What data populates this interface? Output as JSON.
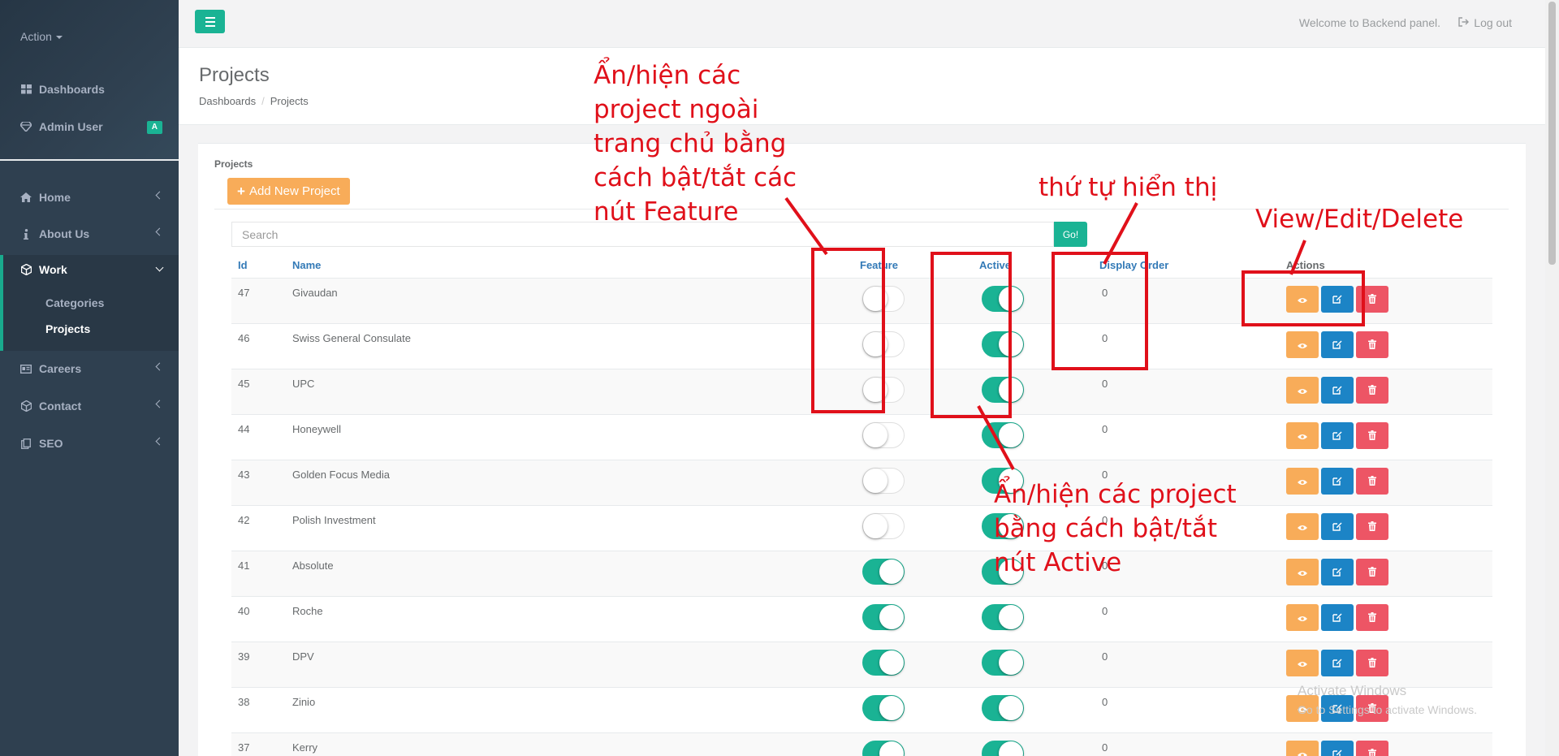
{
  "sidebar": {
    "action_label": "Action",
    "top_items": [
      {
        "label": "Dashboards",
        "icon": "dashboard-icon"
      },
      {
        "label": "Admin User",
        "icon": "diamond-icon",
        "badge": "A"
      }
    ],
    "menu": [
      {
        "label": "Home",
        "icon": "home-icon"
      },
      {
        "label": "About Us",
        "icon": "info-icon"
      },
      {
        "label": "Work",
        "icon": "cube-icon",
        "expanded": true,
        "children": [
          "Categories",
          "Projects"
        ]
      },
      {
        "label": "Careers",
        "icon": "id-card-icon"
      },
      {
        "label": "Contact",
        "icon": "cube-icon"
      },
      {
        "label": "SEO",
        "icon": "seo-icon"
      }
    ]
  },
  "topbar": {
    "welcome": "Welcome to Backend panel.",
    "logout": "Log out"
  },
  "heading": {
    "title": "Projects",
    "breadcrumb": [
      "Dashboards",
      "Projects"
    ]
  },
  "panel": {
    "title": "Projects",
    "add_button": "Add New Project",
    "search_placeholder": "Search",
    "go_button": "Go!"
  },
  "table": {
    "headers": {
      "id": "Id",
      "name": "Name",
      "feature": "Feature",
      "active": "Active",
      "display_order": "Display Order",
      "actions": "Actions"
    },
    "rows": [
      {
        "id": "47",
        "name": "Givaudan",
        "feature": false,
        "active": true,
        "order": "0"
      },
      {
        "id": "46",
        "name": "Swiss General Consulate",
        "feature": false,
        "active": true,
        "order": "0"
      },
      {
        "id": "45",
        "name": "UPC",
        "feature": false,
        "active": true,
        "order": "0"
      },
      {
        "id": "44",
        "name": "Honeywell",
        "feature": false,
        "active": true,
        "order": "0"
      },
      {
        "id": "43",
        "name": "Golden Focus Media",
        "feature": false,
        "active": true,
        "order": "0"
      },
      {
        "id": "42",
        "name": "Polish Investment",
        "feature": false,
        "active": true,
        "order": "0"
      },
      {
        "id": "41",
        "name": "Absolute",
        "feature": true,
        "active": true,
        "order": "0"
      },
      {
        "id": "40",
        "name": "Roche",
        "feature": true,
        "active": true,
        "order": "0"
      },
      {
        "id": "39",
        "name": "DPV",
        "feature": true,
        "active": true,
        "order": "0"
      },
      {
        "id": "38",
        "name": "Zinio",
        "feature": true,
        "active": true,
        "order": "0"
      },
      {
        "id": "37",
        "name": "Kerry",
        "feature": true,
        "active": true,
        "order": "0"
      }
    ]
  },
  "annotations": {
    "feature_note": [
      "Ẩn/hiện các",
      "project ngoài",
      "trang chủ bằng",
      "cách bật/tắt các",
      "nút Feature"
    ],
    "order_note": "thứ tự hiển thị",
    "actions_note": "View/Edit/Delete",
    "active_note": [
      "Ẩn/hiện các project",
      "bằng cách bật/tắt",
      "nút Active"
    ]
  },
  "watermark": {
    "title": "Activate Windows",
    "subtitle": "Go to Settings to activate Windows."
  },
  "colors": {
    "sidebar_bg": "#2f4050",
    "primary": "#1ab394",
    "warning": "#f8ac59",
    "info": "#1c84c6",
    "danger": "#ed5565",
    "annotation": "#e0101a"
  }
}
